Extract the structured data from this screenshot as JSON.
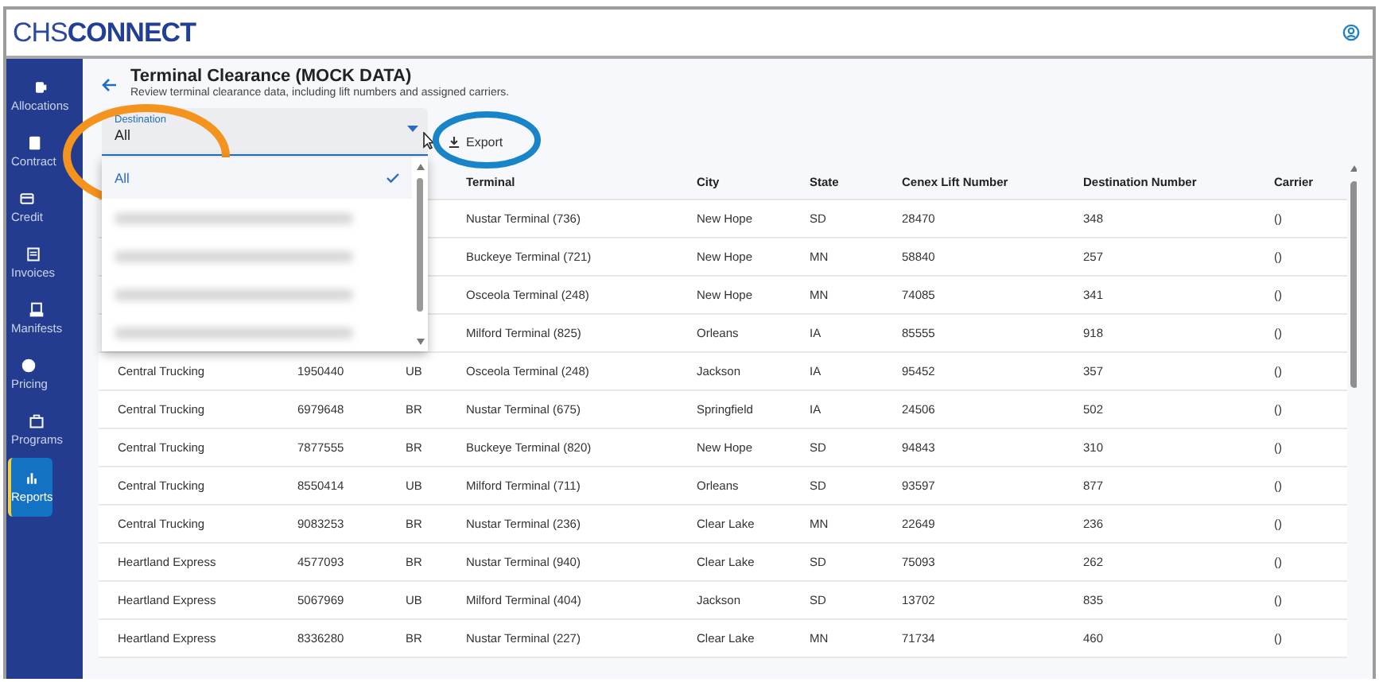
{
  "header": {
    "logo_start": "CHS",
    "logo_end": "CONNECT"
  },
  "sidebar": {
    "items": [
      {
        "label": "Allocations",
        "selected": false
      },
      {
        "label": "Contract",
        "selected": false
      },
      {
        "label": "Credit",
        "selected": false
      },
      {
        "label": "Invoices",
        "selected": false
      },
      {
        "label": "Manifests",
        "selected": false
      },
      {
        "label": "Pricing",
        "selected": false
      },
      {
        "label": "Programs",
        "selected": false
      },
      {
        "label": "Reports",
        "selected": true
      }
    ]
  },
  "page": {
    "title": "Terminal Clearance (MOCK DATA)",
    "subtitle": "Review terminal clearance data, including lift numbers and assigned carriers."
  },
  "destination_select": {
    "label": "Destination",
    "value": "All",
    "expanded": true,
    "options": [
      {
        "kind": "text",
        "label": "All",
        "selected": true
      },
      {
        "kind": "blurred",
        "selected": false
      },
      {
        "kind": "blurred",
        "selected": false
      },
      {
        "kind": "blurred",
        "selected": false
      },
      {
        "kind": "blurred",
        "selected": false
      }
    ]
  },
  "export_button": {
    "label": "Export"
  },
  "table": {
    "columns": [
      null,
      null,
      null,
      "Terminal",
      "City",
      "State",
      "Cenex Lift Number",
      "Destination Number",
      "Carrier"
    ],
    "rows": [
      [
        null,
        null,
        null,
        "Nustar Terminal (736)",
        "New Hope",
        "SD",
        "28470",
        "348",
        "()"
      ],
      [
        null,
        null,
        null,
        "Buckeye Terminal (721)",
        "New Hope",
        "MN",
        "58840",
        "257",
        "()"
      ],
      [
        null,
        null,
        null,
        "Osceola Terminal (248)",
        "New Hope",
        "MN",
        "74085",
        "341",
        "()"
      ],
      [
        null,
        null,
        null,
        "Milford Terminal (825)",
        "Orleans",
        "IA",
        "85555",
        "918",
        "()"
      ],
      [
        "Central Trucking",
        "1950440",
        "UB",
        "Osceola Terminal (248)",
        "Jackson",
        "IA",
        "95452",
        "357",
        "()"
      ],
      [
        "Central Trucking",
        "6979648",
        "BR",
        "Nustar Terminal (675)",
        "Springfield",
        "IA",
        "24506",
        "502",
        "()"
      ],
      [
        "Central Trucking",
        "7877555",
        "BR",
        "Buckeye Terminal (820)",
        "New Hope",
        "SD",
        "94843",
        "310",
        "()"
      ],
      [
        "Central Trucking",
        "8550414",
        "UB",
        "Milford Terminal (711)",
        "Orleans",
        "SD",
        "93597",
        "877",
        "()"
      ],
      [
        "Central Trucking",
        "9083253",
        "BR",
        "Nustar Terminal (236)",
        "Clear Lake",
        "MN",
        "22649",
        "236",
        "()"
      ],
      [
        "Heartland Express",
        "4577093",
        "BR",
        "Nustar Terminal (940)",
        "Clear Lake",
        "SD",
        "75093",
        "262",
        "()"
      ],
      [
        "Heartland Express",
        "5067969",
        "UB",
        "Milford Terminal (404)",
        "Jackson",
        "SD",
        "13702",
        "835",
        "()"
      ],
      [
        "Heartland Express",
        "8336280",
        "BR",
        "Nustar Terminal (227)",
        "Clear Lake",
        "MN",
        "71734",
        "460",
        "()"
      ]
    ]
  }
}
